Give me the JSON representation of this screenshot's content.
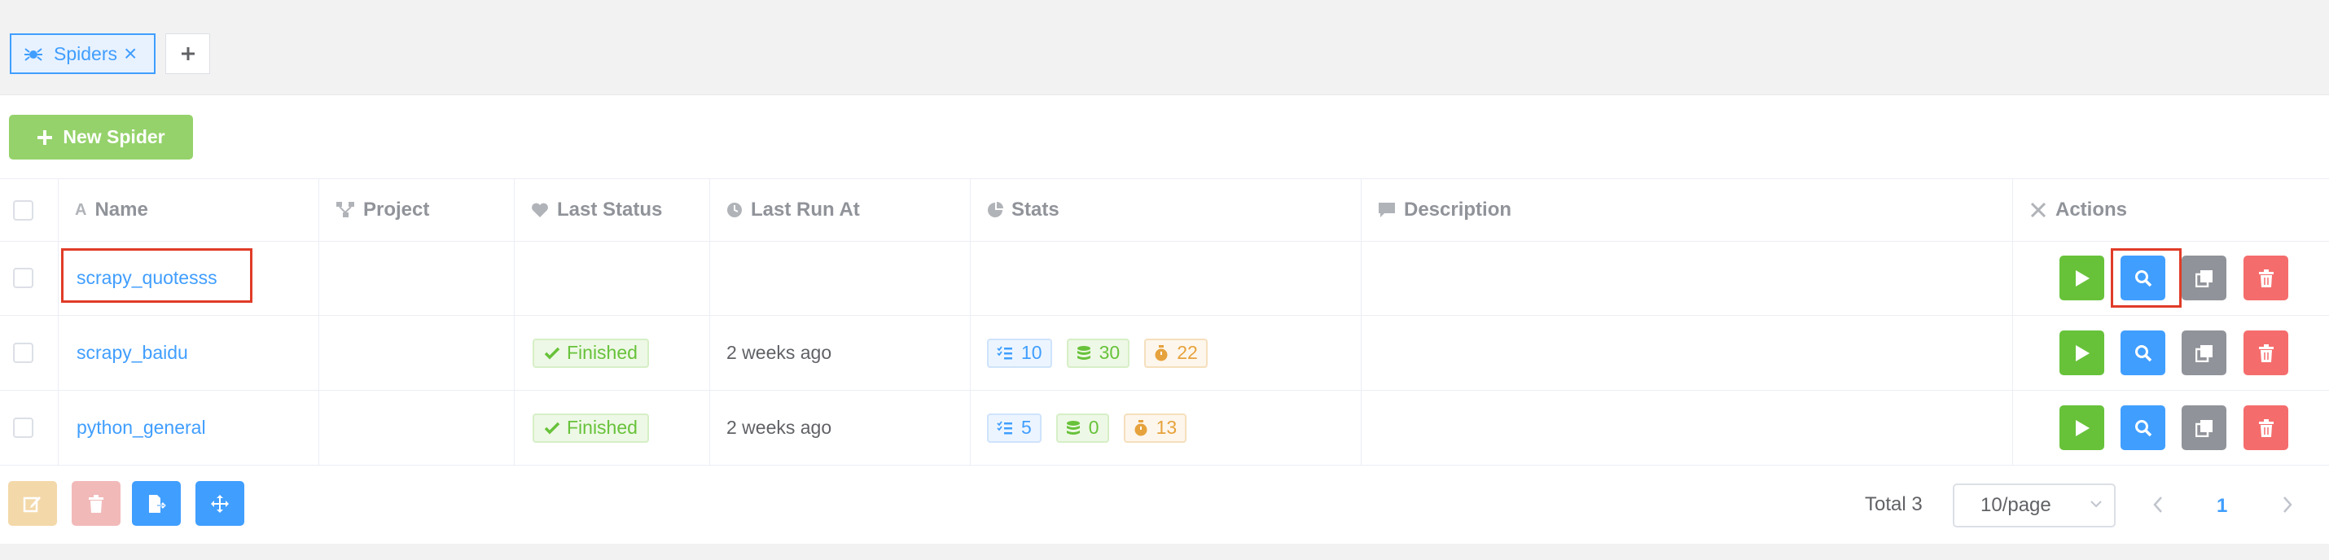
{
  "tabs": [
    {
      "label": "Spiders",
      "icon": "spider-icon",
      "active": true
    }
  ],
  "toolbar": {
    "new_spider_label": "New Spider"
  },
  "table": {
    "headers": {
      "name": "Name",
      "project": "Project",
      "last_status": "Last Status",
      "last_run_at": "Last Run At",
      "stats": "Stats",
      "description": "Description",
      "actions": "Actions"
    },
    "rows": [
      {
        "name": "scrapy_quotesss",
        "project": "",
        "status": "",
        "last_run": "",
        "stats": null,
        "description": ""
      },
      {
        "name": "scrapy_baidu",
        "project": "",
        "status": "Finished",
        "last_run": "2 weeks ago",
        "stats": {
          "tasks": "10",
          "results": "30",
          "duration": "22"
        },
        "description": ""
      },
      {
        "name": "python_general",
        "project": "",
        "status": "Finished",
        "last_run": "2 weeks ago",
        "stats": {
          "tasks": "5",
          "results": "0",
          "duration": "13"
        },
        "description": ""
      }
    ]
  },
  "pagination": {
    "total": "Total 3",
    "page_size": "10/page",
    "current_page": "1"
  },
  "colors": {
    "primary": "#409eff",
    "success": "#67c23a",
    "danger": "#f56c6c",
    "warning": "#e6a23c",
    "info": "#909399",
    "highlight": "#e03c28"
  }
}
